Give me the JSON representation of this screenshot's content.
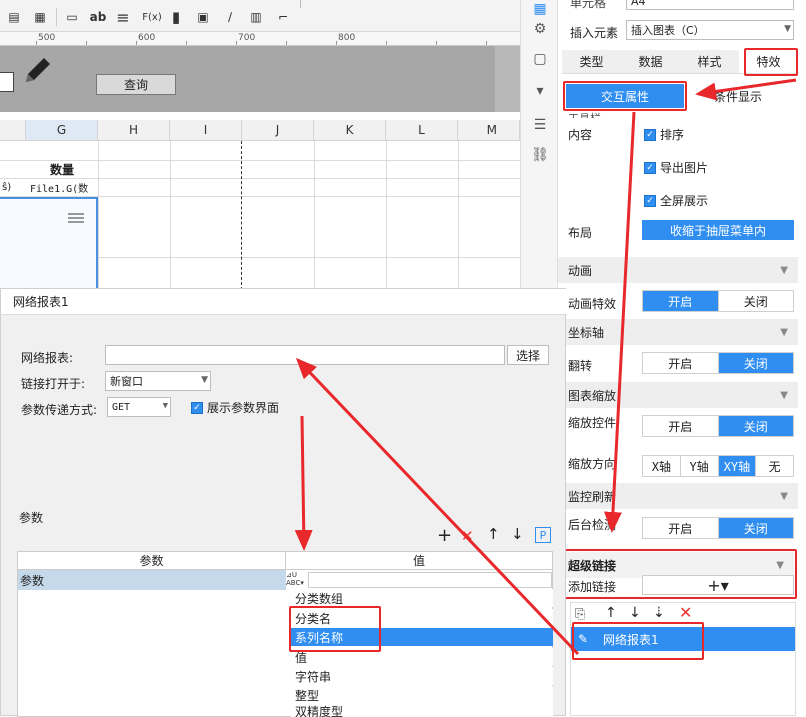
{
  "toolbar": {
    "items": [
      "▤",
      "▦",
      "▭",
      "ab",
      "≡",
      "F(x)",
      "▮",
      "▣",
      "∕",
      "▥",
      "⌐"
    ]
  },
  "ruler": {
    "marks": [
      "500",
      "600",
      "700",
      "800"
    ]
  },
  "param_area": {
    "query_label": "查询"
  },
  "grid": {
    "columns": [
      "G",
      "H",
      "I",
      "J",
      "K",
      "L",
      "M"
    ],
    "header_cell": "数量",
    "row_left_fragment": "ŝ)",
    "formula_cell": "File1.G(数"
  },
  "right_panel": {
    "cell_label": "单元格",
    "cell_value": "A4",
    "insert_label": "插入元素",
    "insert_value": "插入图表（C）",
    "tabs": [
      "类型",
      "数据",
      "样式",
      "特效"
    ],
    "effect_tabs": [
      "交互属性",
      "条件显示"
    ],
    "toolbar_section": "工具栏",
    "content_label": "内容",
    "checkboxes": [
      "排序",
      "导出图片",
      "全屏展示"
    ],
    "layout_label": "布局",
    "layout_value": "收缩于抽屉菜单内",
    "sections": {
      "animation": "动画",
      "axis": "坐标轴",
      "zoom": "图表缩放",
      "monitor": "监控刷新",
      "hyperlink": "超级链接"
    },
    "animation_effect_label": "动画特效",
    "flip_label": "翻转",
    "zoom_control_label": "缩放控件",
    "zoom_direction_label": "缩放方向",
    "backend_label": "后台检测",
    "on": "开启",
    "off": "关闭",
    "directions": [
      "X轴",
      "Y轴",
      "XY轴",
      "无"
    ],
    "add_link_label": "添加链接",
    "add_link_btn": "+▾",
    "link_item": "网络报表1"
  },
  "dialog": {
    "title": "网络报表1",
    "report_label": "网络报表:",
    "report_value": "",
    "choose_btn": "选择",
    "open_label": "链接打开于:",
    "open_value": "新窗口",
    "method_label": "参数传递方式:",
    "method_value": "GET",
    "show_params_label": "展示参数界面",
    "params_label": "参数",
    "table_headers": [
      "参数",
      "值"
    ],
    "row_param": "参数",
    "dropdown_items": [
      "分类数组",
      "分类名",
      "系列名称",
      "值",
      "字符串",
      "整型",
      "双精度型"
    ],
    "selected_item": "系列名称"
  },
  "colors": {
    "accent": "#2f8ef0",
    "annotation": "#e8282b"
  }
}
